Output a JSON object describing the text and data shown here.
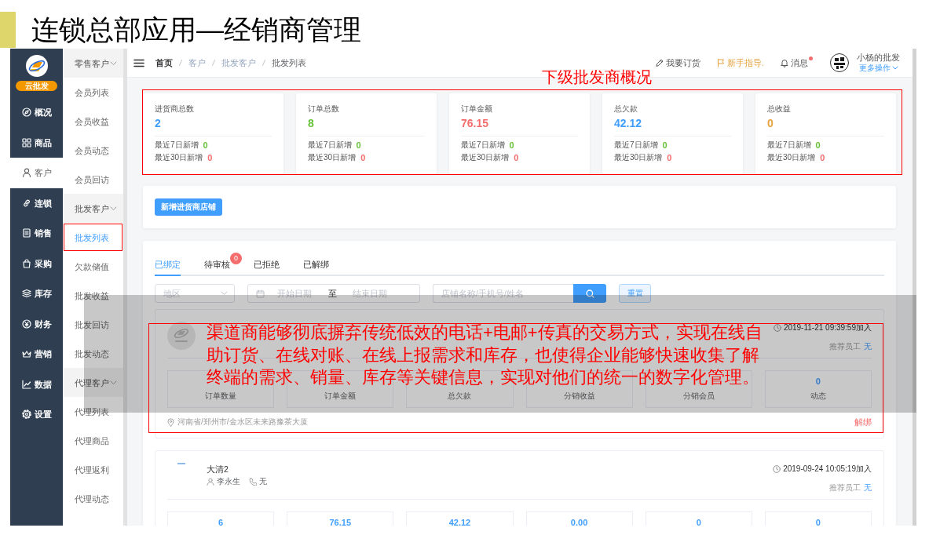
{
  "slide": {
    "title": "连锁总部应用—经销商管理"
  },
  "sidebar": {
    "badge": "云批发",
    "items": [
      {
        "label": "概况",
        "selected": false
      },
      {
        "label": "商品",
        "selected": false
      },
      {
        "label": "客户",
        "selected": true
      },
      {
        "label": "连锁",
        "selected": false
      },
      {
        "label": "销售",
        "selected": false
      },
      {
        "label": "采购",
        "selected": false
      },
      {
        "label": "库存",
        "selected": false
      },
      {
        "label": "财务",
        "selected": false
      },
      {
        "label": "营销",
        "selected": false
      },
      {
        "label": "数据",
        "selected": false
      },
      {
        "label": "设置",
        "selected": false
      }
    ]
  },
  "submenu": [
    {
      "label": "零售客户",
      "expanded": true,
      "items": [
        {
          "label": "会员列表",
          "selected": false,
          "highlighted": false
        },
        {
          "label": "会员收益",
          "selected": false,
          "highlighted": false
        },
        {
          "label": "会员动态",
          "selected": false,
          "highlighted": false
        },
        {
          "label": "会员回访",
          "selected": false,
          "highlighted": false
        }
      ]
    },
    {
      "label": "批发客户",
      "expanded": true,
      "items": [
        {
          "label": "批发列表",
          "selected": true,
          "highlighted": true
        },
        {
          "label": "欠款储值",
          "selected": false,
          "highlighted": false
        },
        {
          "label": "批发收益",
          "selected": false,
          "highlighted": false
        },
        {
          "label": "批发回访",
          "selected": false,
          "highlighted": false
        },
        {
          "label": "批发动态",
          "selected": false,
          "highlighted": false
        }
      ]
    },
    {
      "label": "代理客户",
      "expanded": true,
      "items": [
        {
          "label": "代理列表",
          "selected": false,
          "highlighted": false
        },
        {
          "label": "代理商品",
          "selected": false,
          "highlighted": false
        },
        {
          "label": "代理返利",
          "selected": false,
          "highlighted": false
        },
        {
          "label": "代理动态",
          "selected": false,
          "highlighted": false
        }
      ]
    }
  ],
  "header": {
    "breadcrumb": [
      {
        "label": "首页",
        "kind": "link"
      },
      {
        "label": "客户",
        "kind": "plain"
      },
      {
        "label": "批发客户",
        "kind": "plain"
      },
      {
        "label": "批发列表",
        "kind": "current"
      }
    ],
    "actions": [
      {
        "label": "我要订货",
        "kind": "order",
        "unread": false
      },
      {
        "label": "新手指导.",
        "kind": "guide",
        "unread": false
      },
      {
        "label": "消息",
        "kind": "notice",
        "unread": true
      }
    ],
    "user": {
      "name": "小杨的批发",
      "menu": "更多操作"
    }
  },
  "overview": {
    "highlighted": true,
    "cards": [
      {
        "label": "进货商总数",
        "value": "2",
        "color": "#409eff",
        "recent": [
          {
            "label": "最近7日新增",
            "count": "0",
            "color": "#67c23a"
          },
          {
            "label": "最近30日新增",
            "count": "0",
            "color": "#f56c6c"
          }
        ]
      },
      {
        "label": "订单总数",
        "value": "8",
        "color": "#67c23a",
        "recent": [
          {
            "label": "最近7日新增",
            "count": "0",
            "color": "#67c23a"
          },
          {
            "label": "最近30日新增",
            "count": "0",
            "color": "#f56c6c"
          }
        ]
      },
      {
        "label": "订单金额",
        "value": "76.15",
        "color": "#f56c6c",
        "recent": [
          {
            "label": "最近7日新增",
            "count": "0",
            "color": "#67c23a"
          },
          {
            "label": "最近30日新增",
            "count": "0",
            "color": "#f56c6c"
          }
        ]
      },
      {
        "label": "总欠款",
        "value": "42.12",
        "color": "#409eff",
        "recent": [
          {
            "label": "最近7日新增",
            "count": "0",
            "color": "#67c23a"
          },
          {
            "label": "最近30日新增",
            "count": "0",
            "color": "#f56c6c"
          }
        ]
      },
      {
        "label": "总收益",
        "value": "0",
        "color": "#e6a23c",
        "recent": [
          {
            "label": "最近7日新增",
            "count": "0",
            "color": "#67c23a"
          },
          {
            "label": "最近30日新增",
            "count": "0",
            "color": "#f56c6c"
          }
        ]
      }
    ]
  },
  "add_button": "新增进货商店铺",
  "tabs": [
    {
      "label": "已绑定",
      "selected": true
    },
    {
      "label": "待审核",
      "selected": false,
      "badge": "0"
    },
    {
      "label": "已拒绝",
      "selected": false
    },
    {
      "label": "已解绑",
      "selected": false
    }
  ],
  "filters": {
    "region": {
      "placeholder": "地区"
    },
    "date_range": {
      "start_placeholder": "开始日期",
      "separator": "至",
      "end_placeholder": "结束日期"
    },
    "search": {
      "placeholder": "店铺名称/手机号/姓名"
    },
    "reset_button": "重置"
  },
  "records": [
    {
      "avatar": {
        "kind": "logo"
      },
      "joined": "2019-11-21 09:39:59加入",
      "referrer_label": "推荐员工",
      "referrer": "无",
      "stats": [
        {
          "label": "订单数量"
        },
        {
          "label": "订单金额"
        },
        {
          "label": "总欠款"
        },
        {
          "label": "分销收益"
        },
        {
          "label": "分销会员"
        },
        {
          "value": "0",
          "label": "动态"
        }
      ],
      "address": "河南省/郑州市/金水区未来路豫茶大厦",
      "action": "解绑"
    },
    {
      "avatar": {
        "kind": "stub"
      },
      "name": "大清2",
      "contact": "李永生",
      "phone": "无",
      "joined": "2019-09-24 10:05:19加入",
      "referrer_label": "推荐员工",
      "referrer": "无",
      "stats": [
        {
          "value": "6"
        },
        {
          "value": "76.15"
        },
        {
          "value": "42.12"
        },
        {
          "value": "0.00"
        },
        {
          "value": "0"
        },
        {
          "value": "0"
        }
      ]
    }
  ],
  "annotations": {
    "caption": "下级批发商概况",
    "callout": "渠道商能够彻底摒弃传统低效的电话+电邮+传真的交易方式，实现在线自助订货、在线对账、在线上报需求和库存，也使得企业能够快速收集了解终端的需求、销量、库存等关键信息，实现对他们的统一的数字化管理。",
    "shade_band": true
  }
}
